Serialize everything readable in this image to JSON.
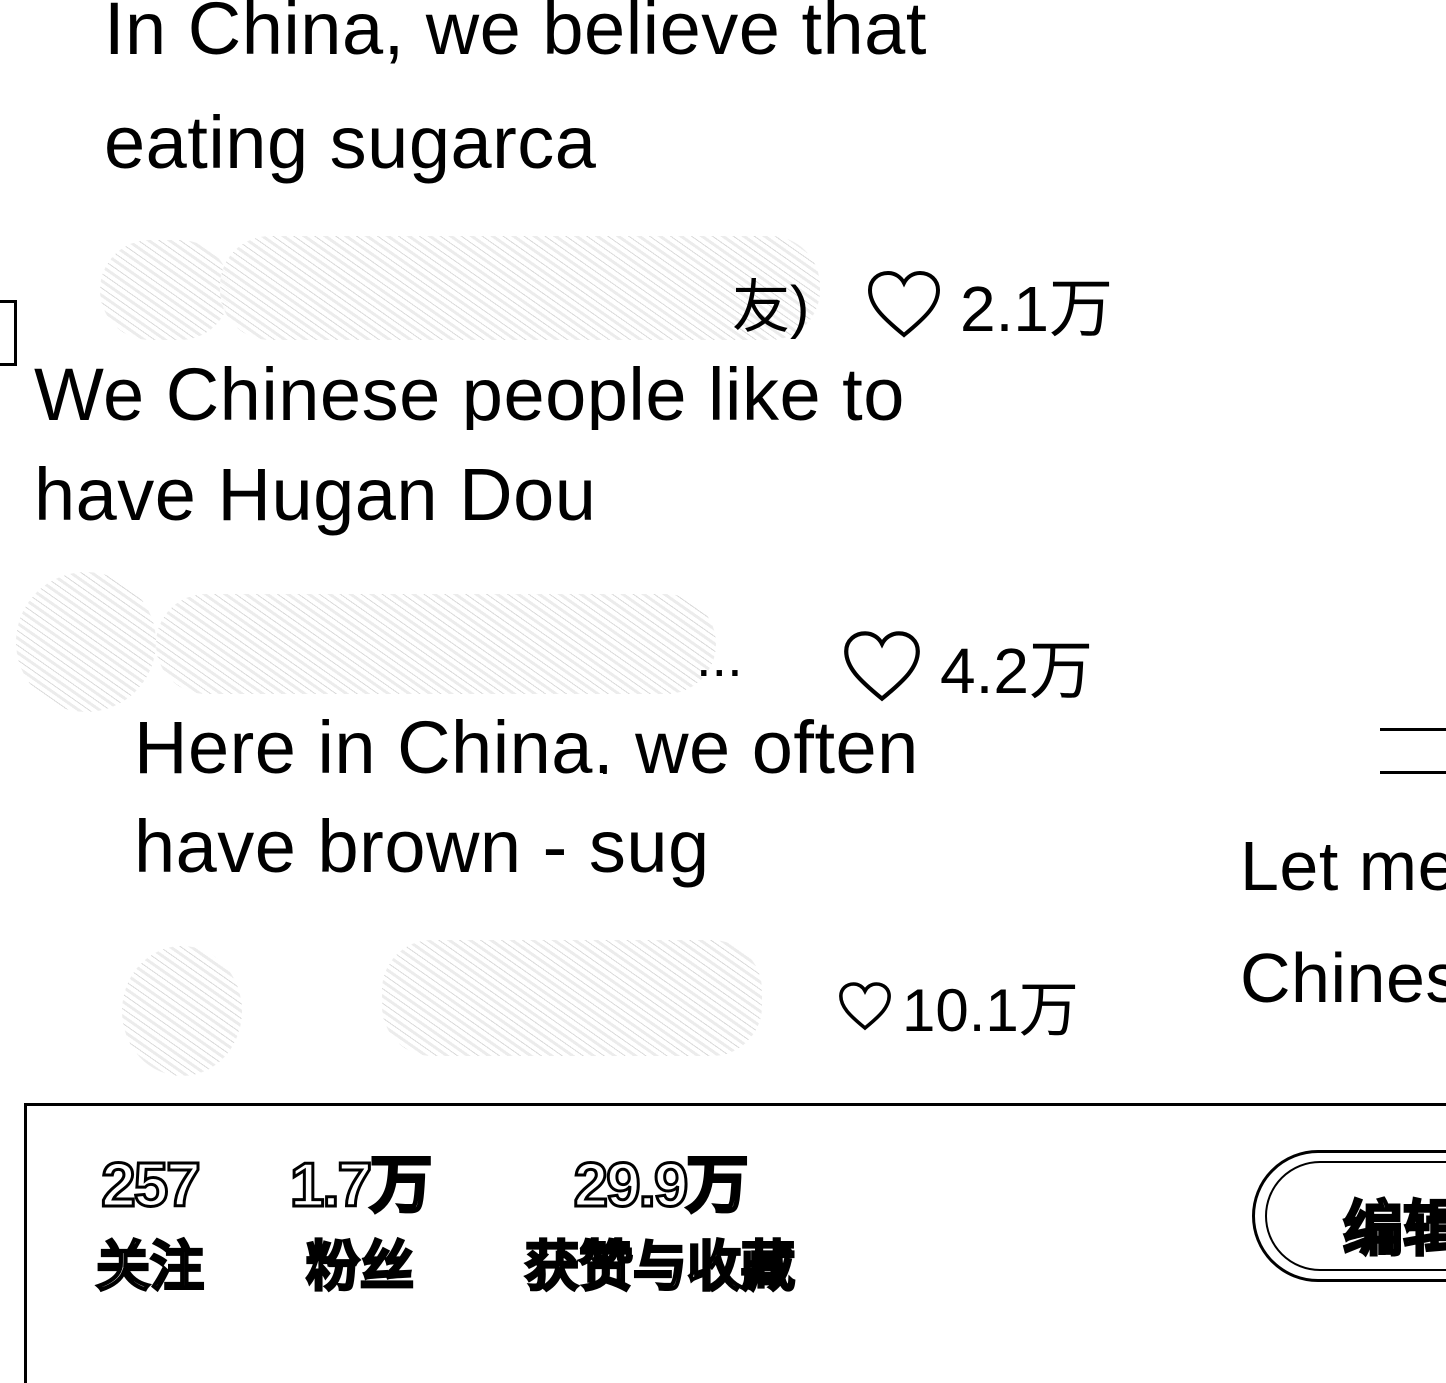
{
  "feed": {
    "cards": [
      {
        "title_line1": "In China, we believe that",
        "title_line2": "eating sugarca",
        "author_tail": "友)",
        "likes": "2.1万"
      },
      {
        "title_line1": "We Chinese people like to",
        "title_line2": "have Hugan Dou",
        "author_tail": "...",
        "likes": "4.2万"
      },
      {
        "title_line1": "Here in China, we often",
        "title_line2": "have brown - sug",
        "author_tail": "",
        "likes": "10.1万"
      },
      {
        "title_line1": "Let me",
        "title_line2": "Chines"
      }
    ]
  },
  "profile": {
    "stats": [
      {
        "value": "257",
        "label": "关注"
      },
      {
        "value": "1.7万",
        "label": "粉丝"
      },
      {
        "value": "29.9万",
        "label": "获赞与收藏"
      }
    ],
    "edit_button_label": "编辑"
  }
}
